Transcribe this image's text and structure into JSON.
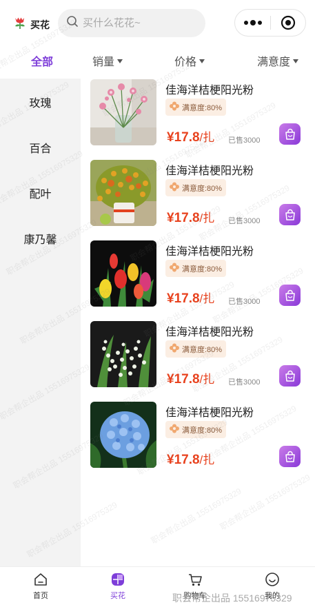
{
  "header": {
    "title": "买花",
    "search_placeholder": "买什么花花~",
    "icons": [
      "tulip-logo-icon",
      "search-icon",
      "more-dots-icon",
      "close-circle-icon"
    ]
  },
  "sort_tabs": [
    {
      "label": "全部",
      "active": true
    },
    {
      "label": "销量",
      "active": false
    },
    {
      "label": "价格",
      "active": false
    },
    {
      "label": "满意度",
      "active": false
    }
  ],
  "categories": [
    "玫瑰",
    "百合",
    "配叶",
    "康乃馨"
  ],
  "products": [
    {
      "name": "佳海洋桔梗阳光粉",
      "rating": "满意度:80%",
      "price": "¥17.8",
      "unit": "/扎",
      "sold": "已售3000"
    },
    {
      "name": "佳海洋桔梗阳光粉",
      "rating": "满意度:80%",
      "price": "¥17.8",
      "unit": "/扎",
      "sold": "已售3000"
    },
    {
      "name": "佳海洋桔梗阳光粉",
      "rating": "满意度:80%",
      "price": "¥17.8",
      "unit": "/扎",
      "sold": "已售3000"
    },
    {
      "name": "佳海洋桔梗阳光粉",
      "rating": "满意度:80%",
      "price": "¥17.8",
      "unit": "/扎",
      "sold": "已售3000"
    },
    {
      "name": "佳海洋桔梗阳光粉",
      "rating": "满意度:80%",
      "price": "¥17.8",
      "unit": "/扎",
      "sold": ""
    }
  ],
  "tabbar": [
    {
      "label": "首页",
      "icon": "home-icon",
      "active": false
    },
    {
      "label": "买花",
      "icon": "shop-icon",
      "active": true
    },
    {
      "label": "购物车",
      "icon": "cart-icon",
      "active": false
    },
    {
      "label": "我的",
      "icon": "smile-profile-icon",
      "active": false
    }
  ],
  "watermark": "职会帮企出品 15516975329",
  "colors": {
    "accent": "#7e3ed9",
    "price": "#e8421e",
    "badge_bg": "#fbeee3",
    "sidebar_bg": "#f3f3f3"
  }
}
